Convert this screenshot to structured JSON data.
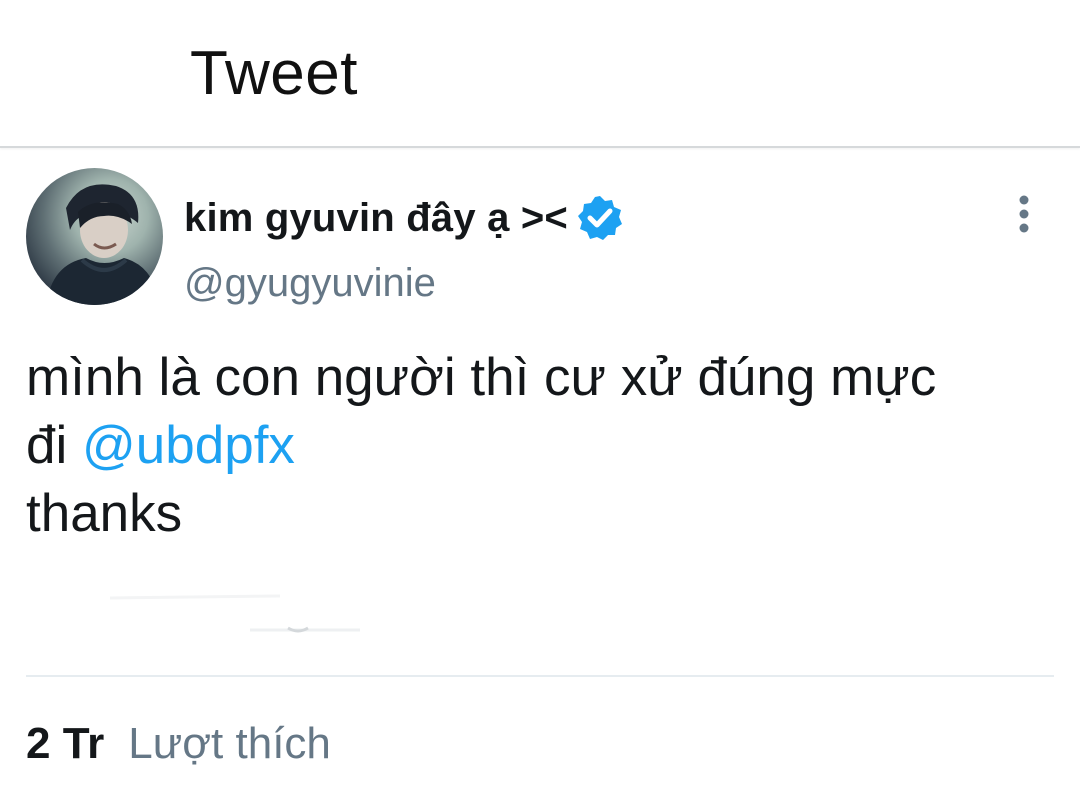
{
  "header": {
    "title": "Tweet"
  },
  "tweet": {
    "author": {
      "display_name": "kim gyuvin đây ạ ><",
      "handle": "@gyugyuvinie",
      "verified": true,
      "avatar_icon": "profile-photo"
    },
    "text_lines": {
      "line1": "mình là con người thì cư xử đúng mực",
      "line2_prefix": "đi ",
      "mention": "@ubdpfx",
      "line3": "thanks"
    },
    "stats": {
      "likes_count": "2 Tr",
      "likes_label": "Lượt thích"
    }
  },
  "colors": {
    "accent": "#1da1f2",
    "secondary_text": "#657786",
    "primary_text": "#14171a",
    "divider": "#e6ecf0"
  }
}
